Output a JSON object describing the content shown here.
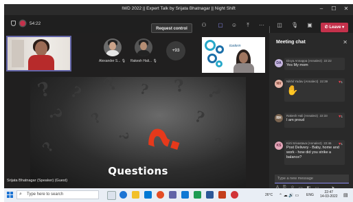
{
  "window": {
    "title": "IWD 2022 || Expert Talk by Srijata Bhatnagar || Night Shift"
  },
  "toolbar": {
    "timer": "54:22",
    "request_control_label": "Request control",
    "more_label": "···",
    "leave_label": "Leave",
    "leave_color": "#c4314b",
    "accent_color": "#6264a7"
  },
  "participants": {
    "tiles": [
      {
        "name": "Alexander S..."
      },
      {
        "name": "Rakesh Hali..."
      }
    ],
    "overflow_count": "+93",
    "logo_text": "tcelern"
  },
  "slide": {
    "heading": "Questions",
    "signature": "Srijata Bhatnagar"
  },
  "speaker_label": "Srijata Bhatnagar (Speaker) (Guest)",
  "chat": {
    "header": "Meeting chat",
    "compose_placeholder": "Type a new message",
    "messages": [
      {
        "initials": "DA",
        "author": "Divya Annappa (Annalect)",
        "time": "22:22",
        "text": "Yes My mom",
        "reactions": ""
      },
      {
        "initials": "NV",
        "author": "Nikhil Yadav (Annalect)",
        "time": "22:39",
        "text": "",
        "reactions": "1"
      },
      {
        "initials": "RH",
        "author": "Rakesh Hali (Annalect)",
        "time": "22:33",
        "text": "I am proud",
        "reactions": "1"
      },
      {
        "initials": "KS",
        "author": "Kirti Srivastava (Annalect)",
        "time": "22:46",
        "text": "Post Delivery - Baby, home and work - how did you strike a balance?",
        "reactions": "1"
      }
    ]
  },
  "taskbar": {
    "search_placeholder": "Type here to search",
    "weather": "26°C",
    "language": "ENG",
    "time": "22:47",
    "date": "14-03-2022"
  }
}
